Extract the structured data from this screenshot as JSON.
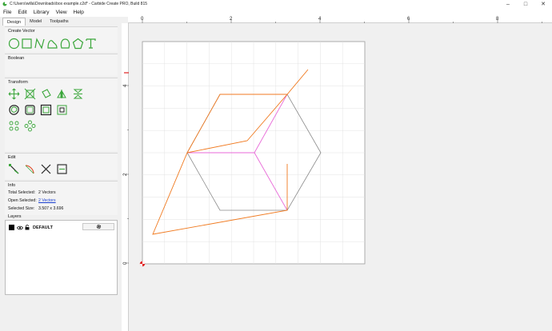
{
  "window": {
    "title": "C:\\Users\\willa\\Downloads\\box example.c2d* - Carbide Create PRO, Build 815"
  },
  "menu": {
    "file": "File",
    "edit": "Edit",
    "library": "Library",
    "view": "View",
    "help": "Help"
  },
  "tabs": {
    "design": "Design",
    "model": "Model",
    "toolpaths": "Toolpaths"
  },
  "sections": {
    "create_vector": "Create Vector",
    "boolean": "Boolean",
    "transform": "Transform",
    "edit": "Edit",
    "info": "Info",
    "layers": "Layers"
  },
  "info": {
    "total_selected_label": "Total Selected:",
    "total_selected_value": "2 Vectors",
    "open_selected_label": "Open Selected:",
    "open_selected_value": "2 Vectors",
    "selected_size_label": "Selected Size:",
    "selected_size_value": "3.507 x 3.696"
  },
  "layers": {
    "name": "DEFAULT",
    "swatch_color": "#000000"
  },
  "ruler": {
    "h_labels": [
      "0",
      "2",
      "4",
      "6",
      "8"
    ],
    "v_labels": [
      "4",
      "2",
      "0"
    ]
  },
  "colors": {
    "accent_green": "#3aa63a",
    "toolpath_orange": "#f07a20",
    "hexagon_gray": "#8a8a8a",
    "cube_edges_magenta": "#e86ad8"
  }
}
